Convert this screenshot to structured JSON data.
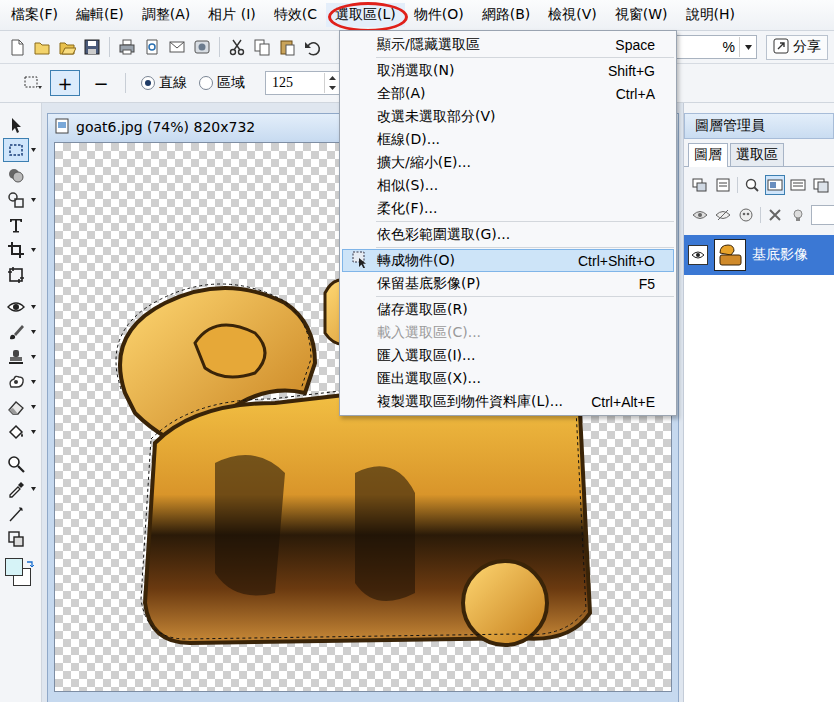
{
  "menubar": [
    {
      "label": "檔案(F)",
      "selected": false,
      "circled": false
    },
    {
      "label": "編輯(E)",
      "selected": false,
      "circled": false
    },
    {
      "label": "調整(A)",
      "selected": false,
      "circled": false
    },
    {
      "label": "相片 (I)",
      "selected": false,
      "circled": false
    },
    {
      "label": "特效(C",
      "selected": false,
      "circled": false
    },
    {
      "label": "選取區(L)",
      "selected": true,
      "circled": true
    },
    {
      "label": "物件(O)",
      "selected": false,
      "circled": false
    },
    {
      "label": "網路(B)",
      "selected": false,
      "circled": false
    },
    {
      "label": "檢視(V)",
      "selected": false,
      "circled": false
    },
    {
      "label": "視窗(W)",
      "selected": false,
      "circled": false
    },
    {
      "label": "說明(H)",
      "selected": false,
      "circled": false
    }
  ],
  "toolbar": {
    "zoom_visible": "%",
    "share_button": "分享"
  },
  "options_bar": {
    "modes": [
      {
        "label": "+",
        "selected": true
      },
      {
        "label": "−",
        "selected": false
      }
    ],
    "shapes": [
      {
        "label": "直線",
        "selected": true
      },
      {
        "label": "區域",
        "selected": false
      }
    ],
    "size": "125"
  },
  "tools": [
    {
      "selected": false,
      "flyout": false
    },
    {
      "selected": true,
      "flyout": true
    },
    {
      "selected": false,
      "flyout": false
    },
    {
      "selected": false,
      "flyout": true
    },
    {
      "selected": false,
      "flyout": false
    },
    {
      "selected": false,
      "flyout": true
    },
    {
      "selected": false,
      "flyout": false
    },
    {
      "selected": false,
      "flyout": true
    },
    {
      "selected": false,
      "flyout": true
    },
    {
      "selected": false,
      "flyout": true
    },
    {
      "selected": false,
      "flyout": true
    },
    {
      "selected": false,
      "flyout": true
    },
    {
      "selected": false,
      "flyout": true
    },
    {
      "selected": false,
      "flyout": false
    },
    {
      "selected": false,
      "flyout": true
    },
    {
      "selected": false,
      "flyout": false
    },
    {
      "selected": false,
      "flyout": false
    }
  ],
  "colors": {
    "foreground": "#d6f3f7",
    "background": "#ffffff"
  },
  "document": {
    "title": "goat6.jpg (74%) 820x732"
  },
  "layer_manager": {
    "title": "圖層管理員",
    "tabs": [
      {
        "label": "圖層",
        "selected": true
      },
      {
        "label": "選取區",
        "selected": false
      }
    ],
    "icons_row1": [
      {
        "selected": false
      },
      {
        "selected": false
      },
      {
        "selected": false
      },
      {
        "selected": true
      },
      {
        "selected": false
      },
      {
        "selected": false
      }
    ],
    "layers": [
      {
        "label": "基底影像",
        "selected": true
      }
    ]
  },
  "menu": {
    "items": [
      {
        "kind": "item",
        "label": "顯示/隱藏選取區",
        "shortcut": "Space",
        "selected": false,
        "disabled": false
      },
      {
        "kind": "separator"
      },
      {
        "kind": "item",
        "label": "取消選取(N)",
        "shortcut": "Shift+G",
        "selected": false,
        "disabled": false
      },
      {
        "kind": "item",
        "label": "全部(A)",
        "shortcut": "Ctrl+A",
        "selected": false,
        "disabled": false
      },
      {
        "kind": "item",
        "label": "改選未選取部分(V)",
        "shortcut": "",
        "selected": false,
        "disabled": false
      },
      {
        "kind": "item",
        "label": "框線(D)...",
        "shortcut": "",
        "selected": false,
        "disabled": false
      },
      {
        "kind": "item",
        "label": "擴大/縮小(E)...",
        "shortcut": "",
        "selected": false,
        "disabled": false
      },
      {
        "kind": "item",
        "label": "相似(S)...",
        "shortcut": "",
        "selected": false,
        "disabled": false
      },
      {
        "kind": "item",
        "label": "柔化(F)...",
        "shortcut": "",
        "selected": false,
        "disabled": false
      },
      {
        "kind": "separator"
      },
      {
        "kind": "item",
        "label": "依色彩範圍選取(G)...",
        "shortcut": "",
        "selected": false,
        "disabled": false
      },
      {
        "kind": "separator"
      },
      {
        "kind": "item",
        "label": "轉成物件(O)",
        "shortcut": "Ctrl+Shift+O",
        "selected": true,
        "disabled": false
      },
      {
        "kind": "item",
        "label": "保留基底影像(P)",
        "shortcut": "F5",
        "selected": false,
        "disabled": false
      },
      {
        "kind": "separator"
      },
      {
        "kind": "item",
        "label": "儲存選取區(R)",
        "shortcut": "",
        "selected": false,
        "disabled": false
      },
      {
        "kind": "item",
        "label": "載入選取區(C)...",
        "shortcut": "",
        "selected": false,
        "disabled": true
      },
      {
        "kind": "item",
        "label": "匯入選取區(I)...",
        "shortcut": "",
        "selected": false,
        "disabled": false
      },
      {
        "kind": "item",
        "label": "匯出選取區(X)...",
        "shortcut": "",
        "selected": false,
        "disabled": false
      },
      {
        "kind": "item",
        "label": "複製選取區到物件資料庫(L)...",
        "shortcut": "Ctrl+Alt+E",
        "selected": false,
        "disabled": false
      }
    ]
  }
}
